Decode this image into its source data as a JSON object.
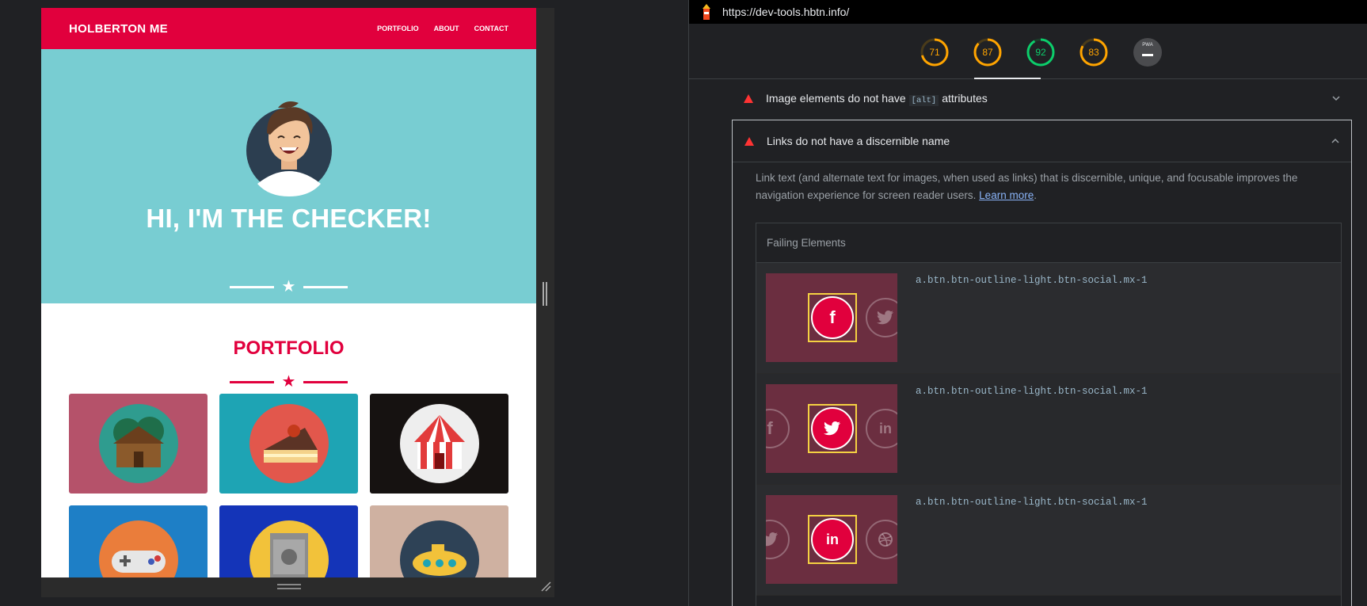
{
  "site": {
    "brand": "HOLBERTON ME",
    "nav": [
      "PORTFOLIO",
      "ABOUT",
      "CONTACT"
    ],
    "hero_title": "HI, I'M THE CHECKER!",
    "portfolio_title": "PORTFOLIO",
    "colors": {
      "nav": "#e1003d",
      "hero": "#78cdd2",
      "accent": "#e1003d"
    },
    "tiles": [
      {
        "name": "cabin",
        "bg": "#b5526a"
      },
      {
        "name": "cake",
        "bg": "#1ea4b4"
      },
      {
        "name": "circus-tent",
        "bg": "#161211"
      },
      {
        "name": "game-controller",
        "bg": "#1e7fc6"
      },
      {
        "name": "safe",
        "bg": "#1434b8"
      },
      {
        "name": "submarine",
        "bg": "#cfb1a1"
      }
    ]
  },
  "lighthouse": {
    "url": "https://dev-tools.hbtn.info/",
    "gauges": [
      {
        "label": "71",
        "score": 71,
        "color": "#ffa400"
      },
      {
        "label": "87",
        "score": 87,
        "color": "#ffa400"
      },
      {
        "label": "92",
        "score": 92,
        "color": "#0cce6b"
      },
      {
        "label": "83",
        "score": 83,
        "color": "#ffa400"
      },
      {
        "label": "PWA",
        "score": null,
        "color": "#9aa0a6"
      }
    ],
    "audits": [
      {
        "title_prefix": "Image elements do not have",
        "title_code": "[alt]",
        "title_suffix": "attributes",
        "expanded": false
      },
      {
        "title": "Links do not have a discernible name",
        "expanded": true,
        "description": "Link text (and alternate text for images, when used as links) that is discernible, unique, and focusable improves the navigation experience for screen reader users.",
        "learn_more": "Learn more",
        "failing_header": "Failing Elements",
        "items": [
          {
            "selector": "a.btn.btn-outline-light.btn-social.mx-1",
            "focused_icon": "f",
            "left_icon": "",
            "right_icon": "twitter"
          },
          {
            "selector": "a.btn.btn-outline-light.btn-social.mx-1",
            "focused_icon": "twitter",
            "left_icon": "f",
            "right_icon": "in"
          },
          {
            "selector": "a.btn.btn-outline-light.btn-social.mx-1",
            "focused_icon": "in",
            "left_icon": "twitter",
            "right_icon": "dribbble"
          }
        ]
      }
    ]
  }
}
